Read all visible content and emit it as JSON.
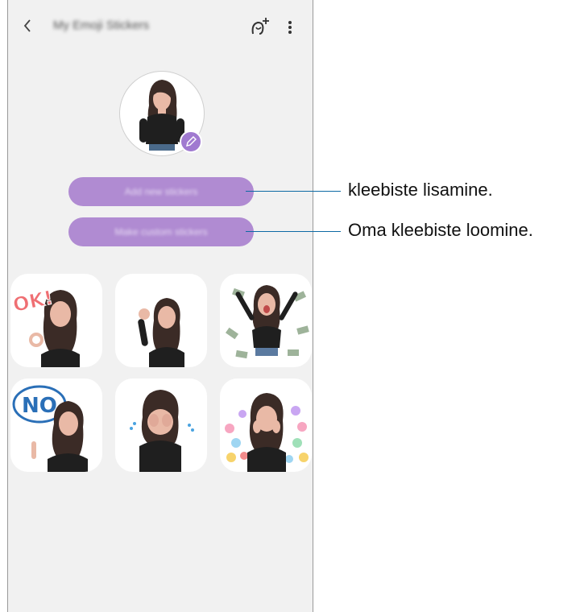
{
  "header": {
    "title": "My Emoji Stickers",
    "back_icon": "chevron-left-icon",
    "avatar_add_icon": "avatar-add-icon",
    "more_icon": "more-vertical-icon"
  },
  "profile": {
    "avatar_icon": "avatar-icon",
    "edit_icon": "pencil-icon"
  },
  "buttons": {
    "add_label": "Add new stickers",
    "make_label": "Make custom stickers"
  },
  "stickers": [
    {
      "name": "sticker-ok",
      "text": "OK!"
    },
    {
      "name": "sticker-wave",
      "text": ""
    },
    {
      "name": "sticker-money",
      "text": ""
    },
    {
      "name": "sticker-no",
      "text": "NO"
    },
    {
      "name": "sticker-cry",
      "text": ""
    },
    {
      "name": "sticker-hearts",
      "text": ""
    }
  ],
  "annotations": {
    "add": "kleebiste lisamine.",
    "make": "Oma kleebiste loomine."
  },
  "colors": {
    "accent": "#b08bd2",
    "callout_line": "#0d6aa4",
    "background": "#f1f1f1"
  }
}
